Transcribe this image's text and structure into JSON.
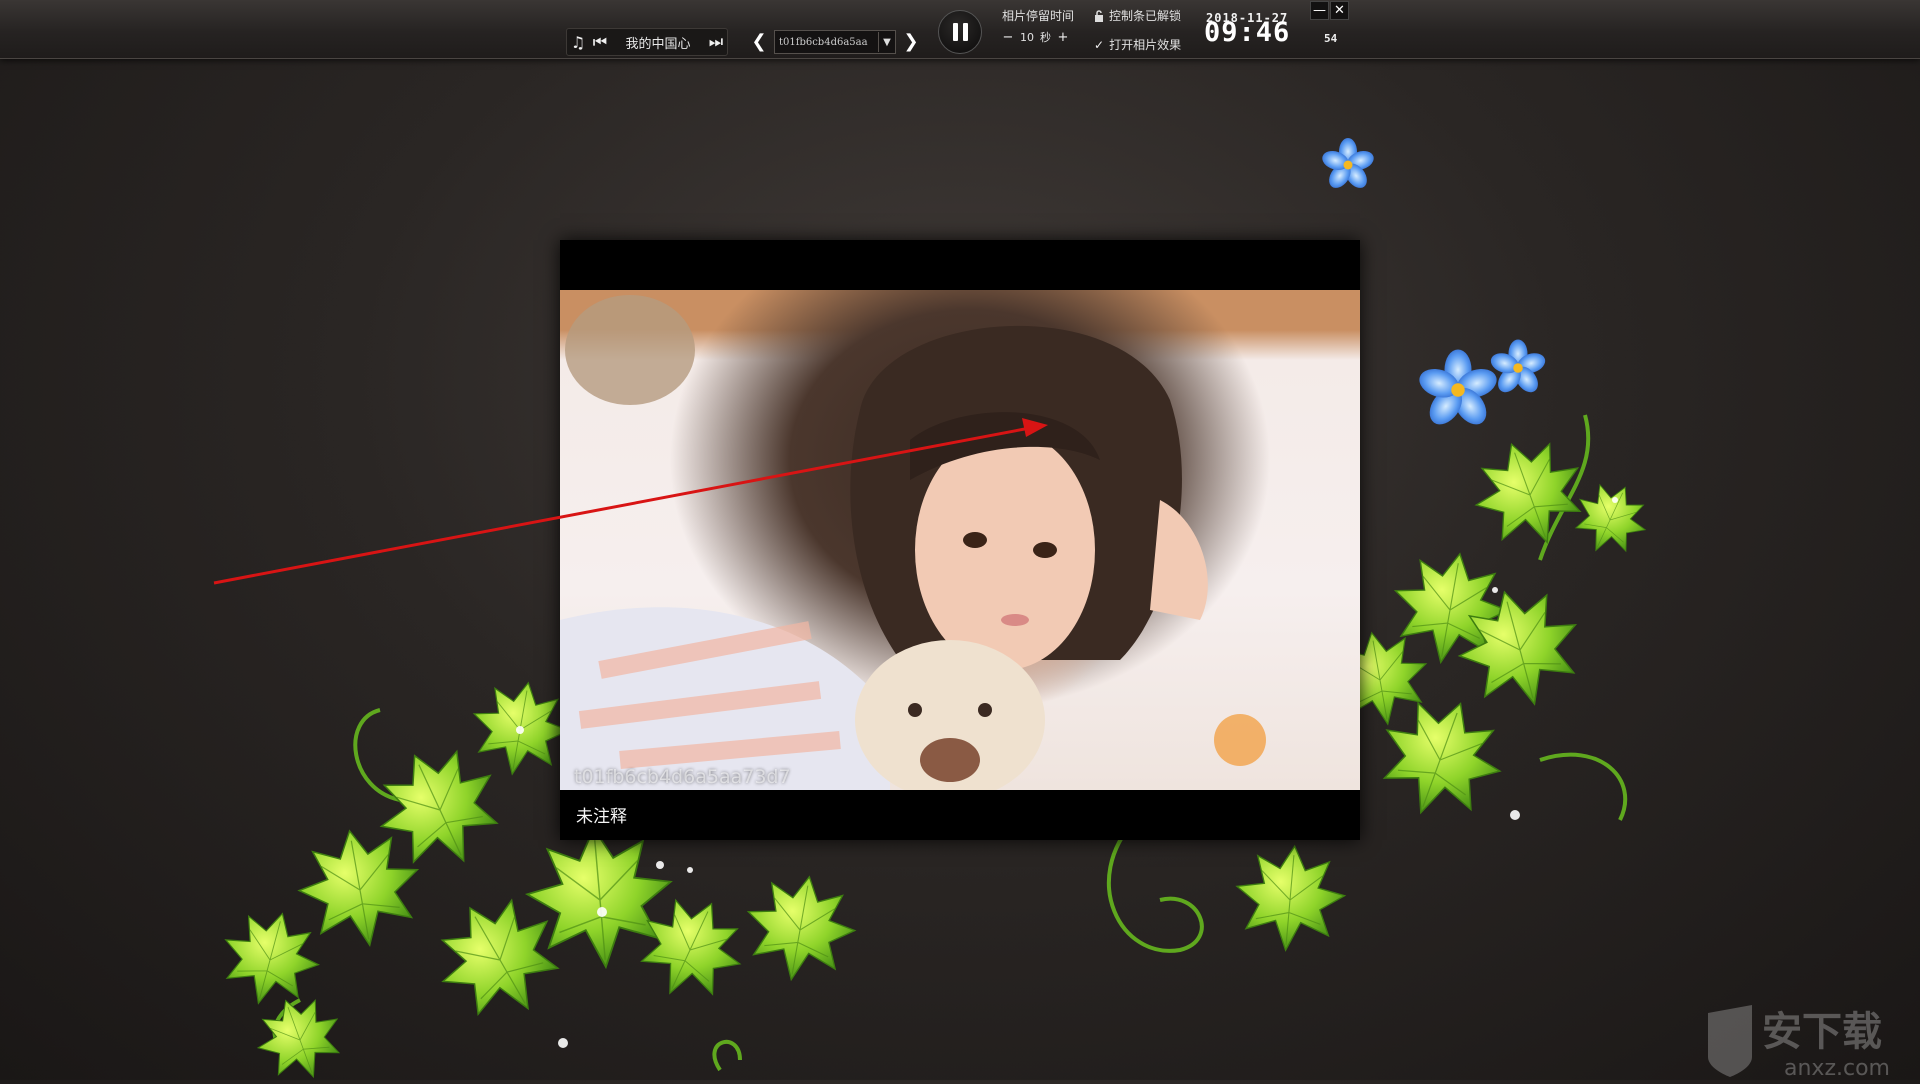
{
  "topbar": {
    "music_label": "我的中国心",
    "photo_select_value": "t01fb6cb4d6a5aa",
    "dwell_label": "相片停留时间",
    "dwell_value": "10",
    "dwell_unit": "秒",
    "lock_label": "控制条已解锁",
    "effect_label": "打开相片效果",
    "date": "2018-11-27",
    "time": "09:46",
    "seconds": "54"
  },
  "photo": {
    "filename": "t01fb6cb4d6a5aa73d7",
    "caption": "未注释"
  },
  "watermark": {
    "text": "安下载",
    "url": "anxz.com"
  },
  "colors": {
    "background": "#2a2624",
    "leaf_green": "#7fc62a",
    "flower_blue": "#4a8ef0",
    "annotation_red": "#d81414"
  }
}
